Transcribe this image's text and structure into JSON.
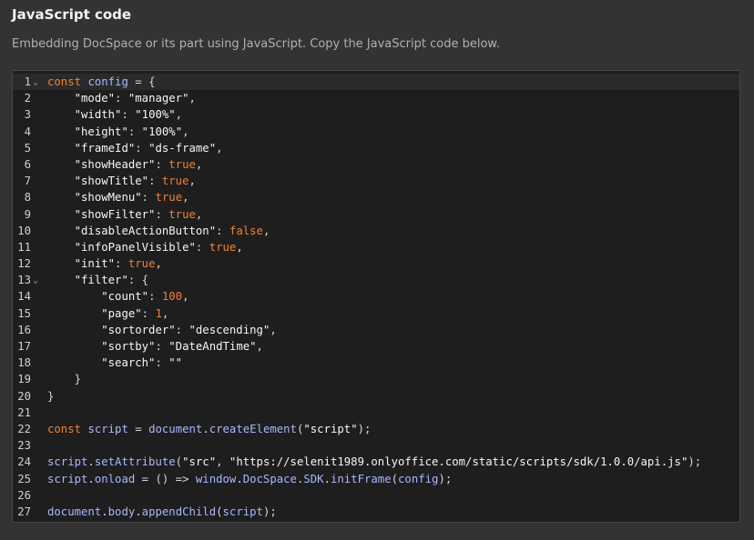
{
  "header": {
    "title": "JavaScript code",
    "description": "Embedding DocSpace or its part using JavaScript. Copy the JavaScript code below."
  },
  "editor": {
    "active_line": 1,
    "fold_markers": [
      1,
      13
    ],
    "lines": [
      [
        {
          "t": "kw",
          "v": "const"
        },
        {
          "t": "p",
          "v": " "
        },
        {
          "t": "id",
          "v": "config"
        },
        {
          "t": "p",
          "v": " = {"
        }
      ],
      [
        {
          "t": "p",
          "v": "    "
        },
        {
          "t": "s",
          "v": "\"mode\""
        },
        {
          "t": "p",
          "v": ": "
        },
        {
          "t": "s",
          "v": "\"manager\""
        },
        {
          "t": "p",
          "v": ","
        }
      ],
      [
        {
          "t": "p",
          "v": "    "
        },
        {
          "t": "s",
          "v": "\"width\""
        },
        {
          "t": "p",
          "v": ": "
        },
        {
          "t": "s",
          "v": "\"100%\""
        },
        {
          "t": "p",
          "v": ","
        }
      ],
      [
        {
          "t": "p",
          "v": "    "
        },
        {
          "t": "s",
          "v": "\"height\""
        },
        {
          "t": "p",
          "v": ": "
        },
        {
          "t": "s",
          "v": "\"100%\""
        },
        {
          "t": "p",
          "v": ","
        }
      ],
      [
        {
          "t": "p",
          "v": "    "
        },
        {
          "t": "s",
          "v": "\"frameId\""
        },
        {
          "t": "p",
          "v": ": "
        },
        {
          "t": "s",
          "v": "\"ds-frame\""
        },
        {
          "t": "p",
          "v": ","
        }
      ],
      [
        {
          "t": "p",
          "v": "    "
        },
        {
          "t": "s",
          "v": "\"showHeader\""
        },
        {
          "t": "p",
          "v": ": "
        },
        {
          "t": "kv",
          "v": "true"
        },
        {
          "t": "p",
          "v": ","
        }
      ],
      [
        {
          "t": "p",
          "v": "    "
        },
        {
          "t": "s",
          "v": "\"showTitle\""
        },
        {
          "t": "p",
          "v": ": "
        },
        {
          "t": "kv",
          "v": "true"
        },
        {
          "t": "p",
          "v": ","
        }
      ],
      [
        {
          "t": "p",
          "v": "    "
        },
        {
          "t": "s",
          "v": "\"showMenu\""
        },
        {
          "t": "p",
          "v": ": "
        },
        {
          "t": "kv",
          "v": "true"
        },
        {
          "t": "p",
          "v": ","
        }
      ],
      [
        {
          "t": "p",
          "v": "    "
        },
        {
          "t": "s",
          "v": "\"showFilter\""
        },
        {
          "t": "p",
          "v": ": "
        },
        {
          "t": "kv",
          "v": "true"
        },
        {
          "t": "p",
          "v": ","
        }
      ],
      [
        {
          "t": "p",
          "v": "    "
        },
        {
          "t": "s",
          "v": "\"disableActionButton\""
        },
        {
          "t": "p",
          "v": ": "
        },
        {
          "t": "kv",
          "v": "false"
        },
        {
          "t": "p",
          "v": ","
        }
      ],
      [
        {
          "t": "p",
          "v": "    "
        },
        {
          "t": "s",
          "v": "\"infoPanelVisible\""
        },
        {
          "t": "p",
          "v": ": "
        },
        {
          "t": "kv",
          "v": "true"
        },
        {
          "t": "p",
          "v": ","
        }
      ],
      [
        {
          "t": "p",
          "v": "    "
        },
        {
          "t": "s",
          "v": "\"init\""
        },
        {
          "t": "p",
          "v": ": "
        },
        {
          "t": "kv",
          "v": "true"
        },
        {
          "t": "p",
          "v": ","
        }
      ],
      [
        {
          "t": "p",
          "v": "    "
        },
        {
          "t": "s",
          "v": "\"filter\""
        },
        {
          "t": "p",
          "v": ": {"
        }
      ],
      [
        {
          "t": "p",
          "v": "        "
        },
        {
          "t": "s",
          "v": "\"count\""
        },
        {
          "t": "p",
          "v": ": "
        },
        {
          "t": "n",
          "v": "100"
        },
        {
          "t": "p",
          "v": ","
        }
      ],
      [
        {
          "t": "p",
          "v": "        "
        },
        {
          "t": "s",
          "v": "\"page\""
        },
        {
          "t": "p",
          "v": ": "
        },
        {
          "t": "n",
          "v": "1"
        },
        {
          "t": "p",
          "v": ","
        }
      ],
      [
        {
          "t": "p",
          "v": "        "
        },
        {
          "t": "s",
          "v": "\"sortorder\""
        },
        {
          "t": "p",
          "v": ": "
        },
        {
          "t": "s",
          "v": "\"descending\""
        },
        {
          "t": "p",
          "v": ","
        }
      ],
      [
        {
          "t": "p",
          "v": "        "
        },
        {
          "t": "s",
          "v": "\"sortby\""
        },
        {
          "t": "p",
          "v": ": "
        },
        {
          "t": "s",
          "v": "\"DateAndTime\""
        },
        {
          "t": "p",
          "v": ","
        }
      ],
      [
        {
          "t": "p",
          "v": "        "
        },
        {
          "t": "s",
          "v": "\"search\""
        },
        {
          "t": "p",
          "v": ": "
        },
        {
          "t": "s",
          "v": "\"\""
        }
      ],
      [
        {
          "t": "p",
          "v": "    }"
        }
      ],
      [
        {
          "t": "p",
          "v": "}"
        }
      ],
      [],
      [
        {
          "t": "kw",
          "v": "const"
        },
        {
          "t": "p",
          "v": " "
        },
        {
          "t": "id",
          "v": "script"
        },
        {
          "t": "p",
          "v": " = "
        },
        {
          "t": "id",
          "v": "document"
        },
        {
          "t": "p",
          "v": "."
        },
        {
          "t": "id",
          "v": "createElement"
        },
        {
          "t": "p",
          "v": "("
        },
        {
          "t": "s",
          "v": "\"script\""
        },
        {
          "t": "p",
          "v": ");"
        }
      ],
      [],
      [
        {
          "t": "id",
          "v": "script"
        },
        {
          "t": "p",
          "v": "."
        },
        {
          "t": "id",
          "v": "setAttribute"
        },
        {
          "t": "p",
          "v": "("
        },
        {
          "t": "s",
          "v": "\"src\""
        },
        {
          "t": "p",
          "v": ", "
        },
        {
          "t": "s",
          "v": "\"https://selenit1989.onlyoffice.com/static/scripts/sdk/1.0.0/api.js\""
        },
        {
          "t": "p",
          "v": ");"
        }
      ],
      [
        {
          "t": "id",
          "v": "script"
        },
        {
          "t": "p",
          "v": "."
        },
        {
          "t": "id",
          "v": "onload"
        },
        {
          "t": "p",
          "v": " = () => "
        },
        {
          "t": "id",
          "v": "window"
        },
        {
          "t": "p",
          "v": "."
        },
        {
          "t": "id",
          "v": "DocSpace"
        },
        {
          "t": "p",
          "v": "."
        },
        {
          "t": "id",
          "v": "SDK"
        },
        {
          "t": "p",
          "v": "."
        },
        {
          "t": "id",
          "v": "initFrame"
        },
        {
          "t": "p",
          "v": "("
        },
        {
          "t": "id",
          "v": "config"
        },
        {
          "t": "p",
          "v": ");"
        }
      ],
      [],
      [
        {
          "t": "id",
          "v": "document"
        },
        {
          "t": "p",
          "v": "."
        },
        {
          "t": "id",
          "v": "body"
        },
        {
          "t": "p",
          "v": "."
        },
        {
          "t": "id",
          "v": "appendChild"
        },
        {
          "t": "p",
          "v": "("
        },
        {
          "t": "id",
          "v": "script"
        },
        {
          "t": "p",
          "v": ");"
        }
      ]
    ]
  }
}
